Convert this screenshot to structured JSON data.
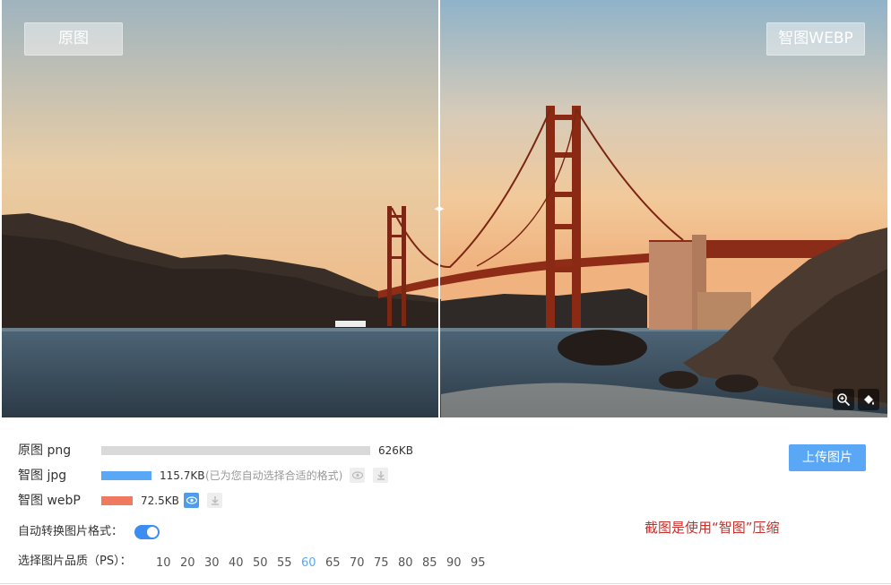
{
  "viewer": {
    "left_label": "原图",
    "right_label": "智图WEBP",
    "zoom_tool": "zoom-in-icon",
    "paint_tool": "paint-bucket-icon",
    "divider_handle": "◂▸"
  },
  "formats": [
    {
      "label": "原图 png",
      "size": "626KB",
      "fraction": 1.0,
      "color": "#d9d9d9"
    },
    {
      "label": "智图 jpg",
      "size": "115.7KB",
      "hint": "(已为您自动选择合适的格式)",
      "fraction": 0.185,
      "color": "#5aa7f5"
    },
    {
      "label": "智图 webP",
      "size": "72.5KB",
      "fraction": 0.116,
      "color": "#f07a5f"
    }
  ],
  "upload_label": "上传图片",
  "note": "截图是使用“智图”压缩",
  "auto_convert_label": "自动转换图片格式：",
  "auto_convert_on": true,
  "quality_label": "选择图片品质（PS）：",
  "quality_options": [
    "10",
    "20",
    "30",
    "40",
    "50",
    "55",
    "60",
    "65",
    "70",
    "75",
    "80",
    "85",
    "90",
    "95"
  ],
  "quality_selected": "60"
}
